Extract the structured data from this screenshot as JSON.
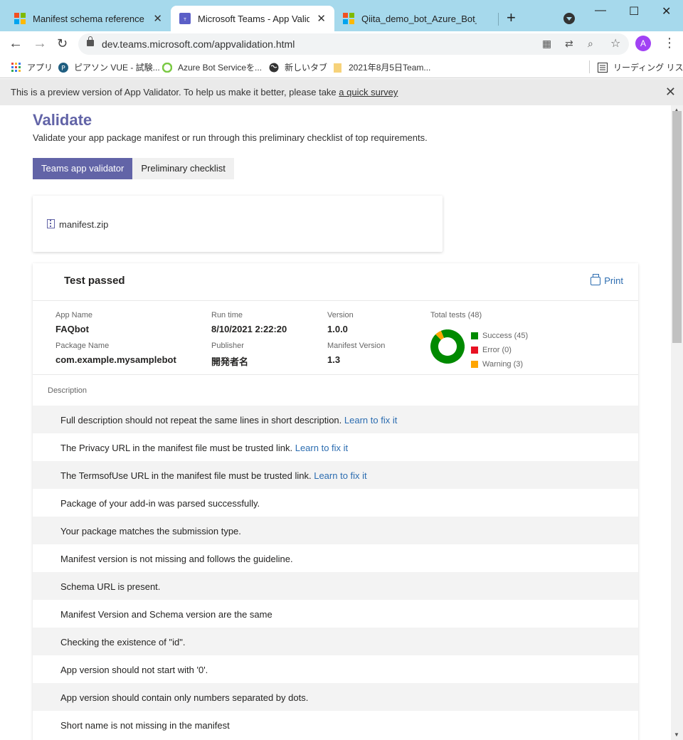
{
  "browser": {
    "tabs": [
      {
        "title": "Manifest schema reference - Te",
        "active": false
      },
      {
        "title": "Microsoft Teams - App Validato",
        "active": true
      },
      {
        "title": "Qiita_demo_bot_Azure_Bot_Ser",
        "active": false
      }
    ],
    "url": "dev.teams.microsoft.com/appvalidation.html",
    "avatar_letter": "A",
    "bookmarks": [
      {
        "label": "アプリ",
        "icon": "apps-grid-icon"
      },
      {
        "label": "ピアソン VUE - 試験...",
        "icon": "pearson-icon"
      },
      {
        "label": "Azure Bot Serviceを...",
        "icon": "azure-circle-icon"
      },
      {
        "label": "新しいタブ",
        "icon": "globe-icon"
      },
      {
        "label": "2021年8月5日Team...",
        "icon": "folder-icon"
      }
    ],
    "reading_list": "リーディング リスト"
  },
  "banner": {
    "text": "This is a preview version of App Validator. To help us make it better, please take ",
    "link": "a quick survey"
  },
  "page": {
    "title": "Validate",
    "subtitle": "Validate your app package manifest or run through this preliminary checklist of top requirements.",
    "tabs": [
      "Teams app validator",
      "Preliminary checklist"
    ],
    "file_name": "manifest.zip"
  },
  "result": {
    "status": "Test passed",
    "print_label": "Print",
    "fields": {
      "app_name_label": "App Name",
      "app_name": "FAQbot",
      "run_time_label": "Run time",
      "run_time": "8/10/2021 2:22:20",
      "version_label": "Version",
      "version": "1.0.0",
      "package_name_label": "Package Name",
      "package_name": "com.example.mysamplebot",
      "publisher_label": "Publisher",
      "publisher": "開発者名",
      "manifest_version_label": "Manifest Version",
      "manifest_version": "1.3"
    },
    "total_tests_label": "Total tests (48)",
    "legend": [
      {
        "label": "Success (45)",
        "color": "#008a00"
      },
      {
        "label": "Error (0)",
        "color": "#e81123"
      },
      {
        "label": "Warning (3)",
        "color": "#ffa500"
      }
    ],
    "chart_data": {
      "type": "pie",
      "categories": [
        "Success",
        "Error",
        "Warning"
      ],
      "values": [
        45,
        0,
        3
      ]
    },
    "description_label": "Description",
    "learn_label": "Learn to fix it",
    "rows": [
      {
        "text": "Full description should not repeat the same lines in short description.",
        "fix": true
      },
      {
        "text": "The Privacy URL in the manifest file must be trusted link.",
        "fix": true
      },
      {
        "text": "The TermsofUse URL in the manifest file must be trusted link.",
        "fix": true
      },
      {
        "text": "Package of your add-in was parsed successfully.",
        "fix": false
      },
      {
        "text": "Your package matches the submission type.",
        "fix": false
      },
      {
        "text": "Manifest version is not missing and follows the guideline.",
        "fix": false
      },
      {
        "text": "Schema URL is present.",
        "fix": false
      },
      {
        "text": "Manifest Version and Schema version are the same",
        "fix": false
      },
      {
        "text": "Checking the existence of \"id\".",
        "fix": false
      },
      {
        "text": "App version should not start with '0'.",
        "fix": false
      },
      {
        "text": "App version should contain only numbers separated by dots.",
        "fix": false
      },
      {
        "text": "Short name is not missing in the manifest",
        "fix": false
      }
    ]
  }
}
